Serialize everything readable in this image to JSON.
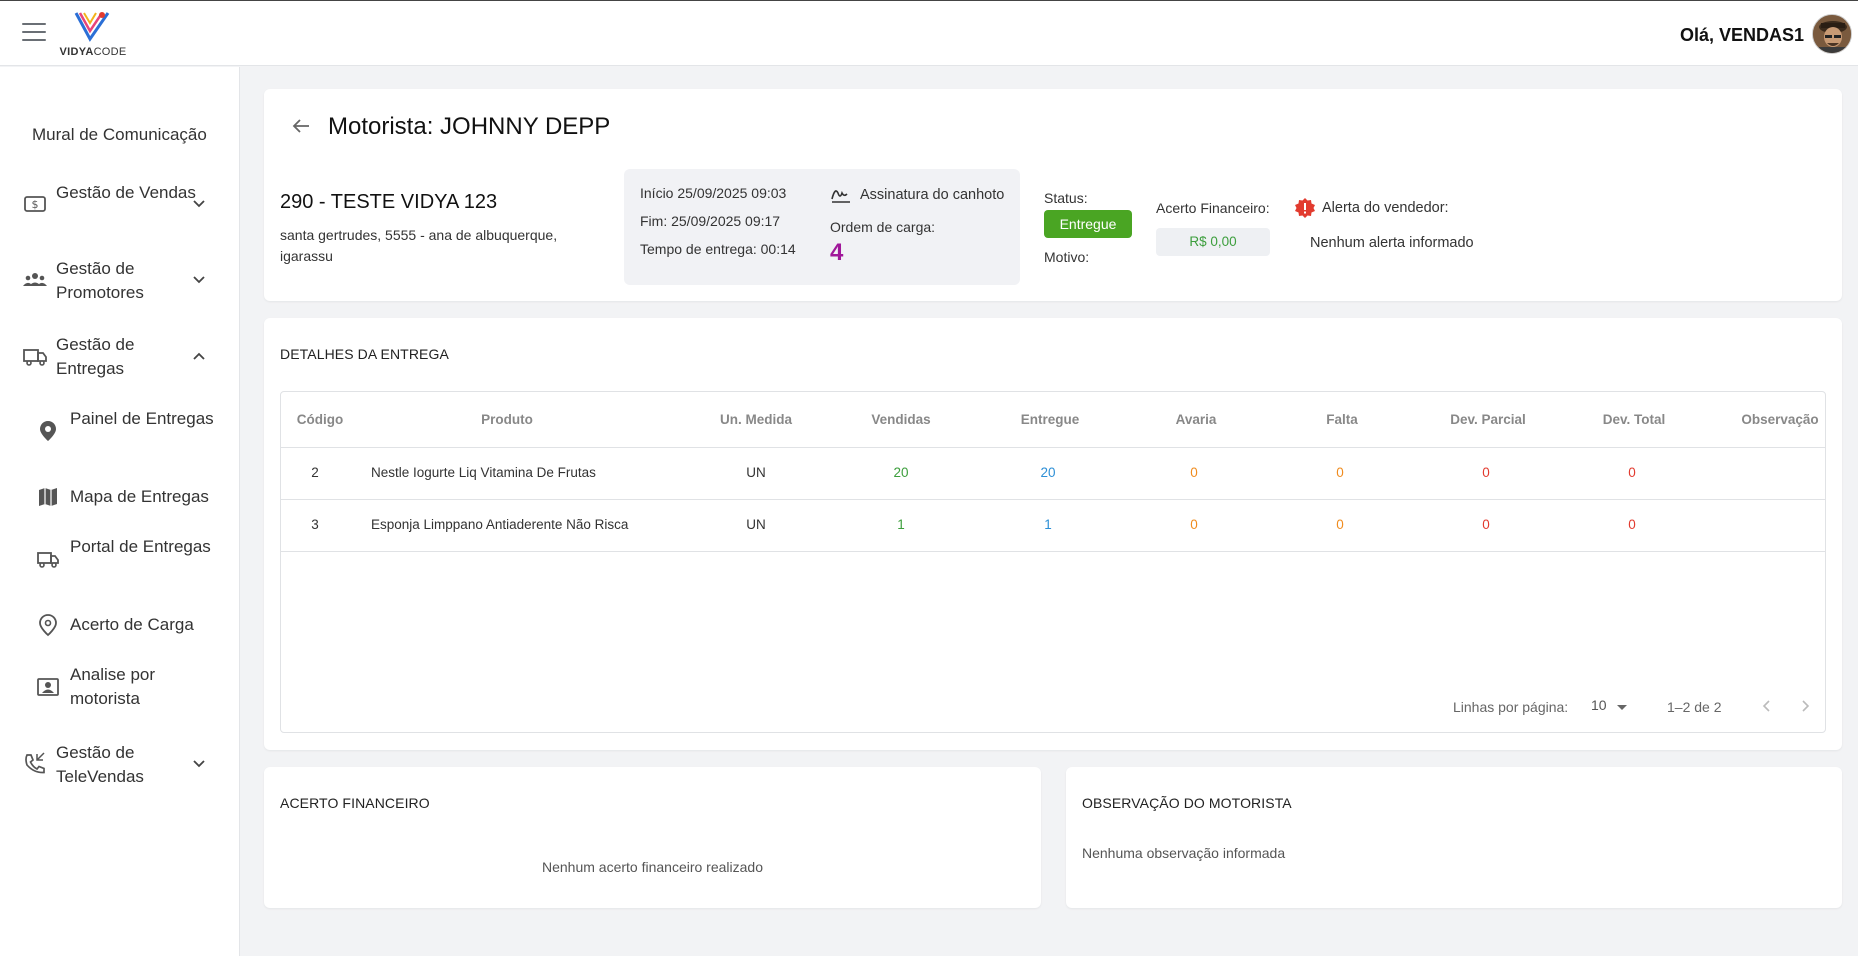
{
  "topbar": {
    "logo_text_bold": "VIDYA",
    "logo_text_light": "CODE",
    "greeting": "Olá, VENDAS1"
  },
  "sidebar": {
    "mural": "Mural de Comunicação",
    "items": [
      {
        "label": "Gestão de Vendas",
        "icon": "dollar-icon",
        "expanded": false
      },
      {
        "label": "Gestão de Promotores",
        "icon": "people-icon",
        "expanded": false
      },
      {
        "label": "Gestão de Entregas",
        "icon": "truck-icon",
        "expanded": true
      },
      {
        "label": "Gestão de TeleVendas",
        "icon": "phone-icon",
        "expanded": false
      }
    ],
    "sub_items": [
      {
        "label": "Painel de Entregas",
        "icon": "location-pin-icon"
      },
      {
        "label": "Mapa de Entregas",
        "icon": "map-icon"
      },
      {
        "label": "Portal de Entregas",
        "icon": "truck-icon"
      },
      {
        "label": "Acerto de Carga",
        "icon": "pin-outline-icon"
      },
      {
        "label": "Analise por motorista",
        "icon": "id-card-icon"
      }
    ]
  },
  "header": {
    "title": "Motorista: JOHNNY DEPP",
    "client_name": "290 - TESTE VIDYA 123",
    "address": "santa gertrudes, 5555 - ana de albuquerque, igarassu",
    "inicio": "Início 25/09/2025 09:03",
    "fim": "Fim: 25/09/2025 09:17",
    "tempo": "Tempo de entrega: 00:14",
    "assinatura": "Assinatura do canhoto",
    "ordem_label": "Ordem de carga:",
    "ordem_value": "4",
    "status_label": "Status:",
    "status_value": "Entregue",
    "motivo_label": "Motivo:",
    "acerto_label": "Acerto Financeiro:",
    "acerto_value": "R$ 0,00",
    "alerta_label": "Alerta do vendedor:",
    "alerta_value": "Nenhum alerta informado"
  },
  "details": {
    "section_title": "DETALHES DA ENTREGA",
    "columns": [
      "Código",
      "Produto",
      "Un. Medida",
      "Vendidas",
      "Entregue",
      "Avaria",
      "Falta",
      "Dev. Parcial",
      "Dev. Total",
      "Observação"
    ],
    "rows": [
      {
        "codigo": "2",
        "produto": "Nestle Iogurte Liq Vitamina De Frutas",
        "un": "UN",
        "vendidas": "20",
        "entregue": "20",
        "avaria": "0",
        "falta": "0",
        "dev_parcial": "0",
        "dev_total": "0",
        "obs": ""
      },
      {
        "codigo": "3",
        "produto": "Esponja Limppano Antiaderente Não Risca",
        "un": "UN",
        "vendidas": "1",
        "entregue": "1",
        "avaria": "0",
        "falta": "0",
        "dev_parcial": "0",
        "dev_total": "0",
        "obs": ""
      }
    ],
    "pager_label": "Linhas por página:",
    "pager_value": "10",
    "pager_range": "1–2 de 2"
  },
  "financeiro": {
    "title": "ACERTO FINANCEIRO",
    "empty": "Nenhum acerto financeiro realizado"
  },
  "observacao": {
    "title": "OBSERVAÇÃO DO MOTORISTA",
    "empty": "Nenhuma observação informada"
  },
  "colors": {
    "status_green": "#4aa523",
    "ordem_purple": "#a0179a",
    "value_green": "#3c9e3c",
    "value_blue": "#2d8fd6",
    "value_orange": "#f08c1f",
    "value_red": "#e23b2f"
  }
}
